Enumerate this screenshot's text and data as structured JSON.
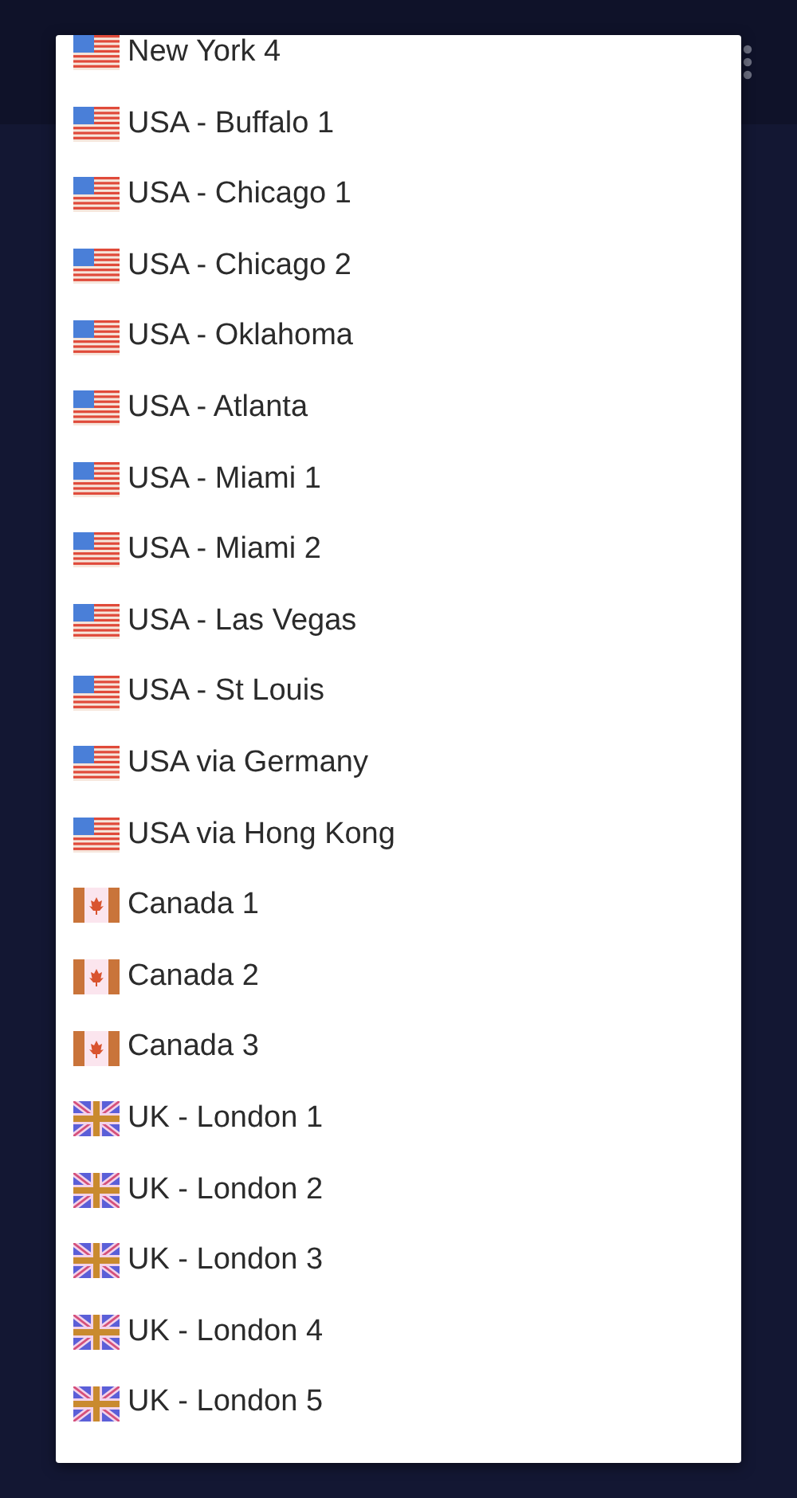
{
  "servers": [
    {
      "name": "New York 4",
      "kind": "us"
    },
    {
      "name": "USA - Buffalo 1",
      "kind": "us"
    },
    {
      "name": "USA - Chicago 1",
      "kind": "us"
    },
    {
      "name": "USA - Chicago 2",
      "kind": "us"
    },
    {
      "name": "USA - Oklahoma",
      "kind": "us"
    },
    {
      "name": "USA - Atlanta",
      "kind": "us"
    },
    {
      "name": "USA - Miami 1",
      "kind": "us"
    },
    {
      "name": "USA - Miami 2",
      "kind": "us"
    },
    {
      "name": "USA - Las Vegas",
      "kind": "us"
    },
    {
      "name": "USA - St Louis",
      "kind": "us"
    },
    {
      "name": "USA via Germany",
      "kind": "us"
    },
    {
      "name": "USA via Hong Kong",
      "kind": "us"
    },
    {
      "name": "Canada 1",
      "kind": "ca"
    },
    {
      "name": "Canada 2",
      "kind": "ca"
    },
    {
      "name": "Canada 3",
      "kind": "ca"
    },
    {
      "name": "UK - London 1",
      "kind": "gb"
    },
    {
      "name": "UK - London 2",
      "kind": "gb"
    },
    {
      "name": "UK - London 3",
      "kind": "gb"
    },
    {
      "name": "UK - London 4",
      "kind": "gb"
    },
    {
      "name": "UK - London 5",
      "kind": "gb"
    }
  ]
}
